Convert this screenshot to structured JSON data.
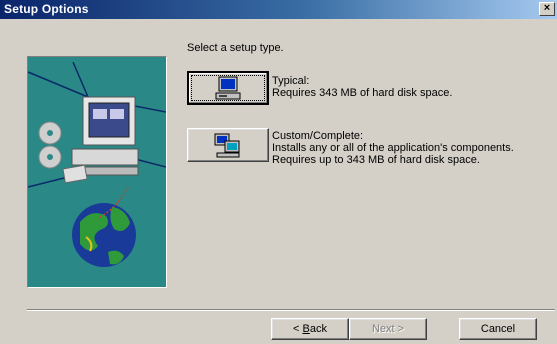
{
  "window": {
    "title": "Setup Options",
    "close_glyph": "×"
  },
  "prompt": "Select a setup type.",
  "options": [
    {
      "title": "Typical:",
      "description": "Requires 343 MB of hard disk space.",
      "icon": "computer-icon"
    },
    {
      "title": "Custom/Complete:",
      "description": "Installs any or all of the application's components. Requires up to 343 MB of hard disk space.",
      "icon": "network-computers-icon"
    }
  ],
  "buttons": {
    "back_prefix": "< ",
    "back_accel": "B",
    "back_rest": "ack",
    "next": "Next >",
    "cancel": "Cancel"
  },
  "colors": {
    "title_start": "#0a246a",
    "title_end": "#a6caf0",
    "art_bg": "#2a8886",
    "face": "#d4d0c8"
  }
}
